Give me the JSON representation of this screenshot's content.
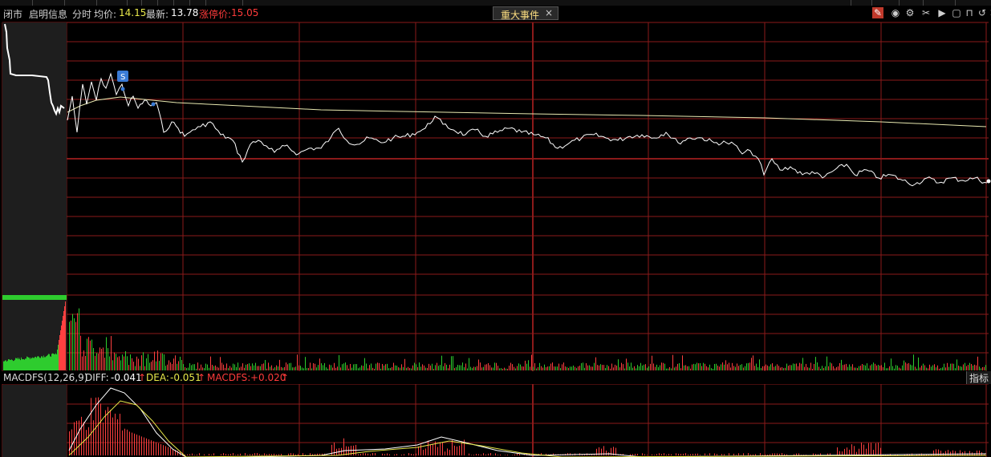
{
  "header": {
    "market_status": "闭市",
    "stock_name": "启明信息",
    "mode": "分时",
    "avg_label": "均价:",
    "avg_value": "14.15",
    "last_label": "最新:",
    "last_value": "13.78",
    "limit_label": "涨停价:",
    "limit_value": "15.05"
  },
  "event_button": {
    "label": "重大事件",
    "close": "×"
  },
  "toolbar_icons": [
    "edit-icon",
    "eye-icon",
    "gear-icon",
    "scissors-icon",
    "play-icon",
    "square-icon",
    "lock-icon",
    "undo-icon",
    "close-icon"
  ],
  "marker": {
    "label": "S"
  },
  "macd": {
    "name": "MACDFS(12,26,9)",
    "diff_label": "DIFF:",
    "diff_value": "-0.041",
    "dea_label": "DEA:",
    "dea_value": "-0.051",
    "macdfs_label": "MACDFS:",
    "macdfs_value": "+0.020",
    "arrow": "↑"
  },
  "indicator_button": {
    "label": "指标"
  },
  "colors": {
    "price_line": "#ffffff",
    "avg_line": "#e8e8b0",
    "grid": "#8b1a1a",
    "vol_up": "#ff4040",
    "vol_down": "#2ecc2e",
    "dea_line": "#e8e84a"
  }
}
